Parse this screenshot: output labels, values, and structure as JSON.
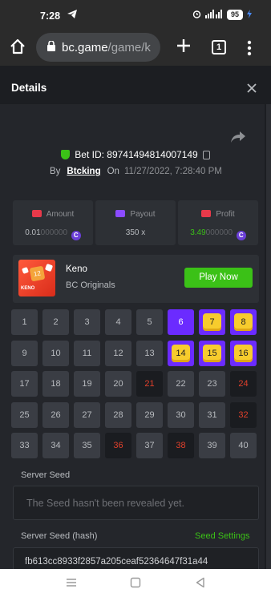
{
  "status": {
    "time": "7:28",
    "icons": "⏰ ᵛᵒˡᵗᵉ",
    "battery": "95"
  },
  "browser": {
    "domain": "bc.game",
    "path": "/game/k",
    "tab_count": "1"
  },
  "header": {
    "title": "Details"
  },
  "bet": {
    "id_label": "Bet ID: 89741494814007149",
    "by_label": "By",
    "user": "Btcking",
    "on_label": "On",
    "date": "11/27/2022, 7:28:40 PM"
  },
  "stats": {
    "amount_label": "Amount",
    "amount_value": "0.01",
    "amount_dim": "000000",
    "payout_label": "Payout",
    "payout_value": "350 x",
    "profit_label": "Profit",
    "profit_value": "3.49",
    "profit_dim": "000000",
    "coin_symbol": "C"
  },
  "game": {
    "name": "Keno",
    "provider": "BC Originals",
    "play_label": "Play Now",
    "thumb_number": "12",
    "thumb_text": "KENO"
  },
  "grid": [
    {
      "n": "1",
      "s": "plain"
    },
    {
      "n": "2",
      "s": "plain"
    },
    {
      "n": "3",
      "s": "plain"
    },
    {
      "n": "4",
      "s": "plain"
    },
    {
      "n": "5",
      "s": "plain"
    },
    {
      "n": "6",
      "s": "pick"
    },
    {
      "n": "7",
      "s": "hit"
    },
    {
      "n": "8",
      "s": "hit"
    },
    {
      "n": "9",
      "s": "plain"
    },
    {
      "n": "10",
      "s": "plain"
    },
    {
      "n": "11",
      "s": "plain"
    },
    {
      "n": "12",
      "s": "plain"
    },
    {
      "n": "13",
      "s": "plain"
    },
    {
      "n": "14",
      "s": "hit"
    },
    {
      "n": "15",
      "s": "hit"
    },
    {
      "n": "16",
      "s": "hit"
    },
    {
      "n": "17",
      "s": "plain"
    },
    {
      "n": "18",
      "s": "plain"
    },
    {
      "n": "19",
      "s": "plain"
    },
    {
      "n": "20",
      "s": "plain"
    },
    {
      "n": "21",
      "s": "miss"
    },
    {
      "n": "22",
      "s": "plain"
    },
    {
      "n": "23",
      "s": "plain"
    },
    {
      "n": "24",
      "s": "miss"
    },
    {
      "n": "25",
      "s": "plain"
    },
    {
      "n": "26",
      "s": "plain"
    },
    {
      "n": "27",
      "s": "plain"
    },
    {
      "n": "28",
      "s": "plain"
    },
    {
      "n": "29",
      "s": "plain"
    },
    {
      "n": "30",
      "s": "plain"
    },
    {
      "n": "31",
      "s": "plain"
    },
    {
      "n": "32",
      "s": "miss"
    },
    {
      "n": "33",
      "s": "plain"
    },
    {
      "n": "34",
      "s": "plain"
    },
    {
      "n": "35",
      "s": "plain"
    },
    {
      "n": "36",
      "s": "miss"
    },
    {
      "n": "37",
      "s": "plain"
    },
    {
      "n": "38",
      "s": "miss"
    },
    {
      "n": "39",
      "s": "plain"
    },
    {
      "n": "40",
      "s": "plain"
    }
  ],
  "seed": {
    "server_label": "Server Seed",
    "server_placeholder": "The Seed hasn't been revealed yet.",
    "hash_label": "Server Seed (hash)",
    "settings_label": "Seed Settings",
    "hash_value": "fb613cc8933f2857a205ceaf52364647f31a44"
  },
  "colors": {
    "accent": "#3bc117",
    "pick": "#6b2bff",
    "hit": "#f7cc2d",
    "miss": "#e0402b"
  }
}
